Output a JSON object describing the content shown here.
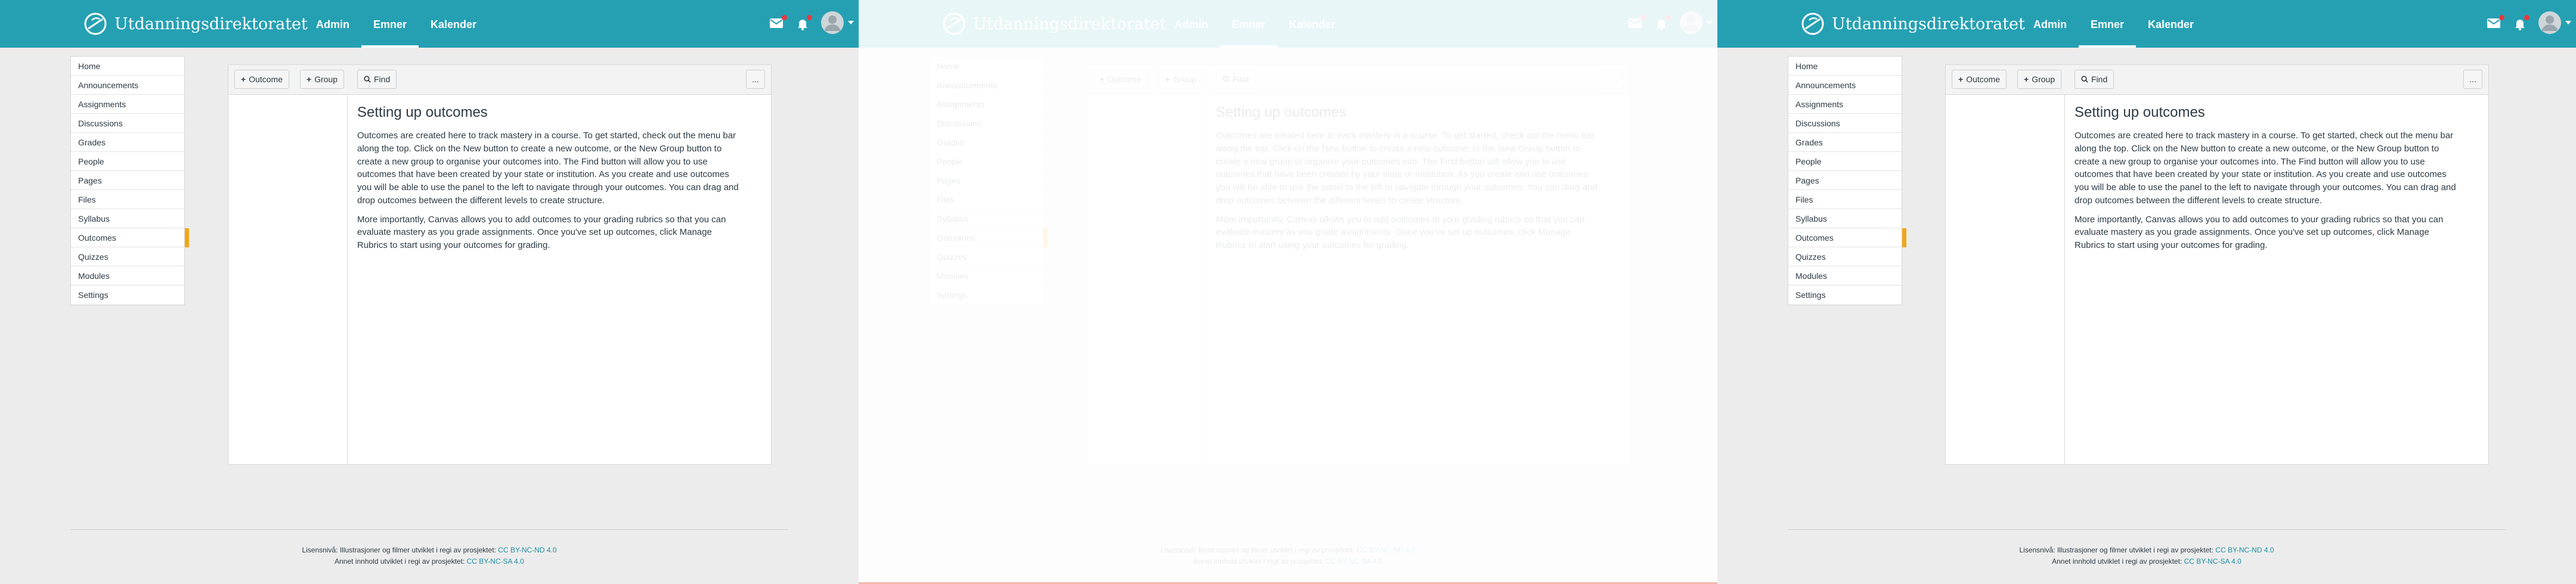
{
  "brand": {
    "name": "Utdanningsdirektoratet",
    "header_color": "#25a0b3",
    "accent_color": "#f1a716"
  },
  "topnav": {
    "items": [
      {
        "label": "Admin"
      },
      {
        "label": "Emner"
      },
      {
        "label": "Kalender"
      }
    ],
    "active_index": 1
  },
  "header_icons": {
    "inbox": "mail-icon",
    "notifications": "bell-icon",
    "profile": "avatar-icon"
  },
  "sidebar": {
    "items": [
      {
        "label": "Home"
      },
      {
        "label": "Announcements"
      },
      {
        "label": "Assignments"
      },
      {
        "label": "Discussions"
      },
      {
        "label": "Grades"
      },
      {
        "label": "People"
      },
      {
        "label": "Pages"
      },
      {
        "label": "Files"
      },
      {
        "label": "Syllabus"
      },
      {
        "label": "Outcomes"
      },
      {
        "label": "Quizzes"
      },
      {
        "label": "Modules"
      },
      {
        "label": "Settings"
      }
    ],
    "active_index": 9
  },
  "toolbar": {
    "outcome_label": "Outcome",
    "group_label": "Group",
    "find_label": "Find",
    "more_label": "..."
  },
  "article": {
    "title": "Setting up outcomes",
    "paragraph1": "Outcomes are created here to track mastery in a course. To get started, check out the menu bar along the top. Click on the New button to create a new outcome, or the New Group button to create a new group to organise your outcomes into. The Find button will allow you to use outcomes that have been created by your state or institution. As you create and use outcomes you will be able to use the panel to the left to navigate through your outcomes. You can drag and drop outcomes between the different levels to create structure.",
    "paragraph2": "More importantly, Canvas allows you to add outcomes to your grading rubrics so that you can evaluate mastery as you grade assignments. Once you've set up outcomes, click Manage Rubrics to start using your outcomes for grading."
  },
  "footer": {
    "line1_text": "Lisensnivå: Illustrasjoner og filmer utviklet i regi av prosjektet:",
    "line1_link": "CC BY-NC-ND 4.0",
    "line2_text": "Annet innhold utviklet i regi av prosjektet:",
    "line2_link": "CC BY-NC-SA 4.0"
  }
}
